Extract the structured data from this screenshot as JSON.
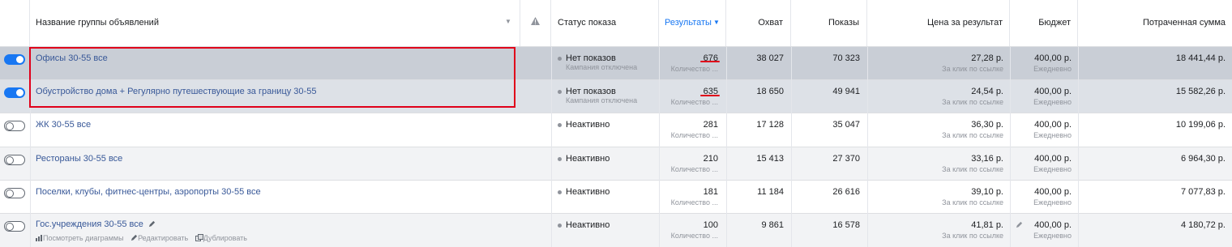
{
  "columns": {
    "name": "Название группы объявлений",
    "status": "Статус показа",
    "results": "Результаты",
    "reach": "Охват",
    "impressions": "Показы",
    "cost": "Цена за результат",
    "budget": "Бюджет",
    "spent": "Потраченная сумма"
  },
  "rows": [
    {
      "on": true,
      "name": "Офисы 30-55 все",
      "status": "Нет показов",
      "status_sub": "Кампания отключена",
      "results": "676",
      "results_sub": "Количество ...",
      "reach": "38 027",
      "impressions": "70 323",
      "cost": "27,28 р.",
      "cost_sub": "За клик по ссылке",
      "budget": "400,00 р.",
      "budget_sub": "Ежедневно",
      "spent": "18 441,44 р."
    },
    {
      "on": true,
      "name": "Обустройство дома + Регулярно путешествующие за границу 30-55",
      "status": "Нет показов",
      "status_sub": "Кампания отключена",
      "results": "635",
      "results_sub": "Количество ...",
      "reach": "18 650",
      "impressions": "49 941",
      "cost": "24,54 р.",
      "cost_sub": "За клик по ссылке",
      "budget": "400,00 р.",
      "budget_sub": "Ежедневно",
      "spent": "15 582,26 р."
    },
    {
      "on": false,
      "name": "ЖК 30-55 все",
      "status": "Неактивно",
      "status_sub": "",
      "results": "281",
      "results_sub": "Количество ...",
      "reach": "17 128",
      "impressions": "35 047",
      "cost": "36,30 р.",
      "cost_sub": "За клик по ссылке",
      "budget": "400,00 р.",
      "budget_sub": "Ежедневно",
      "spent": "10 199,06 р."
    },
    {
      "on": false,
      "name": "Рестораны 30-55 все",
      "status": "Неактивно",
      "status_sub": "",
      "results": "210",
      "results_sub": "Количество ...",
      "reach": "15 413",
      "impressions": "27 370",
      "cost": "33,16 р.",
      "cost_sub": "За клик по ссылке",
      "budget": "400,00 р.",
      "budget_sub": "Ежедневно",
      "spent": "6 964,30 р."
    },
    {
      "on": false,
      "name": "Поселки, клубы, фитнес-центры, аэропорты 30-55 все",
      "status": "Неактивно",
      "status_sub": "",
      "results": "181",
      "results_sub": "Количество ...",
      "reach": "11 184",
      "impressions": "26 616",
      "cost": "39,10 р.",
      "cost_sub": "За клик по ссылке",
      "budget": "400,00 р.",
      "budget_sub": "Ежедневно",
      "spent": "7 077,83 р."
    },
    {
      "on": false,
      "name": "Гос.учреждения 30-55 все",
      "status": "Неактивно",
      "status_sub": "",
      "results": "100",
      "results_sub": "Количество ...",
      "reach": "9 861",
      "impressions": "16 578",
      "cost": "41,81 р.",
      "cost_sub": "За клик по ссылке",
      "budget": "400,00 р.",
      "budget_sub": "Ежедневно",
      "spent": "4 180,72 р."
    }
  ],
  "row_actions": {
    "charts": "Посмотреть диаграммы",
    "edit": "Редактировать",
    "duplicate": "Дублировать"
  },
  "icons": [
    "warning-icon",
    "pencil-icon",
    "chart-icon",
    "duplicate-icon"
  ],
  "accent": "#1877f2",
  "link_color": "#385898",
  "highlight_color": "#e0001a"
}
